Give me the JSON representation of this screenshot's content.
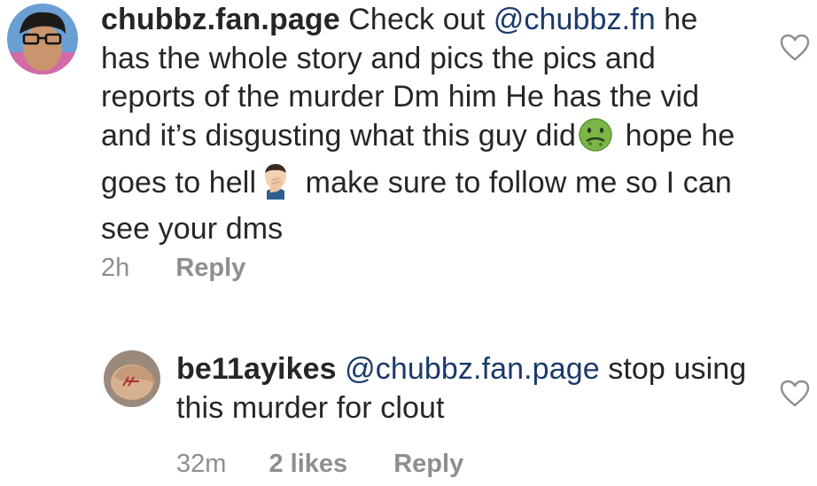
{
  "comments": [
    {
      "username": "chubbz.fan.page",
      "mention": "@chubbz.fn",
      "text_part1": " Check out ",
      "text_part2": " he has the whole story and pics  the pics and reports of the murder Dm him He has the vid and it’s disgusting what this guy did",
      "emoji_1": "nauseated-face-icon",
      "text_part3": " hope he goes to hell",
      "emoji_2": "man-facepalming-icon",
      "text_part4": " make sure to follow me so I can see your dms",
      "time": "2h",
      "reply_label": "Reply"
    },
    {
      "username": "be11ayikes",
      "mention": "@chubbz.fan.page",
      "text_after": " stop using this murder for clout",
      "time": "32m",
      "likes": "2 likes",
      "reply_label": "Reply"
    }
  ],
  "colors": {
    "text": "#262626",
    "mention": "#1a3a6b",
    "meta": "#8e8e8e"
  }
}
